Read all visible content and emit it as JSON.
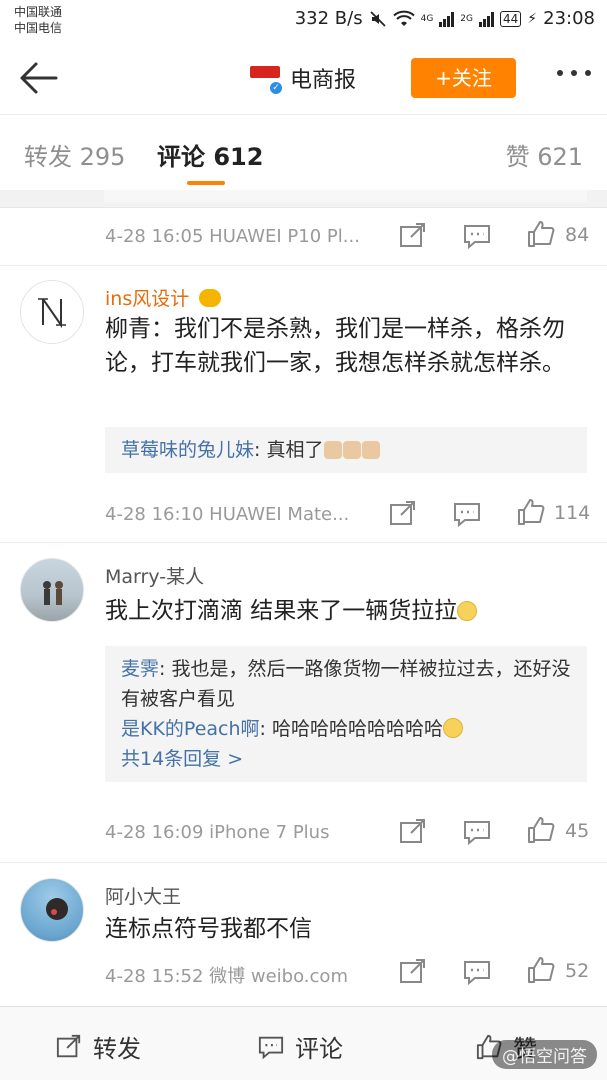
{
  "status_bar": {
    "carrier1": "中国联通",
    "carrier2": "中国电信",
    "speed": "332 B/s",
    "net1": "4G",
    "net2": "2G",
    "battery": "44",
    "time": "23:08"
  },
  "nav": {
    "account_name": "电商报",
    "follow_label": "+关注"
  },
  "tabs": [
    {
      "label": "转发 295",
      "active": false
    },
    {
      "label": "评论 612",
      "active": true
    },
    {
      "label": "赞 621",
      "active": false
    }
  ],
  "comments": [
    {
      "meta": "4-28 16:05  HUAWEI P10 Pl...",
      "likes": "84"
    },
    {
      "username": "ins风设计",
      "content": "柳青：我们不是杀熟，我们是一样杀，格杀勿论，打车就我们一家，我想怎样杀就怎样杀。",
      "replies": [
        {
          "user": "草莓味的兔儿妹",
          "text": ": 真相了"
        }
      ],
      "meta": "4-28 16:10  HUAWEI Mate...",
      "likes": "114"
    },
    {
      "username": "Marry-某人",
      "content": "我上次打滴滴 结果来了一辆货拉拉",
      "replies": [
        {
          "user": "麦霁",
          "text": ": 我也是，然后一路像货物一样被拉过去，还好没有被客户看见"
        },
        {
          "user": "是KK的Peach啊",
          "text": ": 哈哈哈哈哈哈哈哈哈"
        }
      ],
      "more_replies": "共14条回复 >",
      "meta": "4-28 16:09  iPhone 7 Plus",
      "likes": "45"
    },
    {
      "username": "阿小大王",
      "content": "连标点符号我都不信",
      "meta": "4-28 15:52  微博 weibo.com",
      "likes": "52"
    }
  ],
  "bottom_bar": {
    "repost": "转发",
    "comment": "评论",
    "like": "赞"
  },
  "watermark": "@悟空问答",
  "colors": {
    "accent": "#ff8200",
    "link": "#4472a8",
    "vip_name": "#e86b0a"
  }
}
